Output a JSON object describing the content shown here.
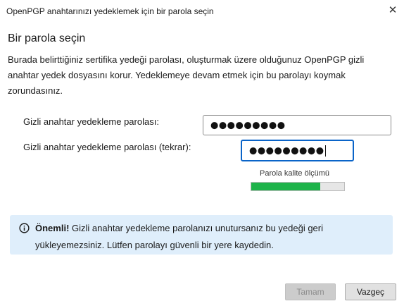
{
  "window": {
    "title": "OpenPGP anahtarınızı yedeklemek için bir parola seçin",
    "close_glyph": "✕"
  },
  "content": {
    "heading": "Bir parola seçin",
    "description": "Burada belirttiğiniz sertifika yedeği parolası, oluşturmak üzere olduğunuz OpenPGP gizli anahtar yedek dosyasını korur. Yedeklemeye devam etmek için bu parolayı koymak zorundasınız."
  },
  "form": {
    "password_label": "Gizli anahtar yedekleme parolası:",
    "password_value": "●●●●●●●●●",
    "confirm_label": "Gizli anahtar yedekleme parolası (tekrar):",
    "confirm_value": "●●●●●●●●●",
    "quality_label": "Parola kalite ölçümü",
    "quality_fraction": 0.74,
    "quality_color": "#1eb34a"
  },
  "notice": {
    "icon": "info-icon",
    "strong": "Önemli!",
    "text": " Gizli anahtar yedekleme parolanızı unutursanız bu yedeği geri yükleyemezsiniz. Lütfen parolayı güvenli bir yere kaydedin."
  },
  "buttons": {
    "ok_label": "Tamam",
    "cancel_label": "Vazgeç"
  }
}
